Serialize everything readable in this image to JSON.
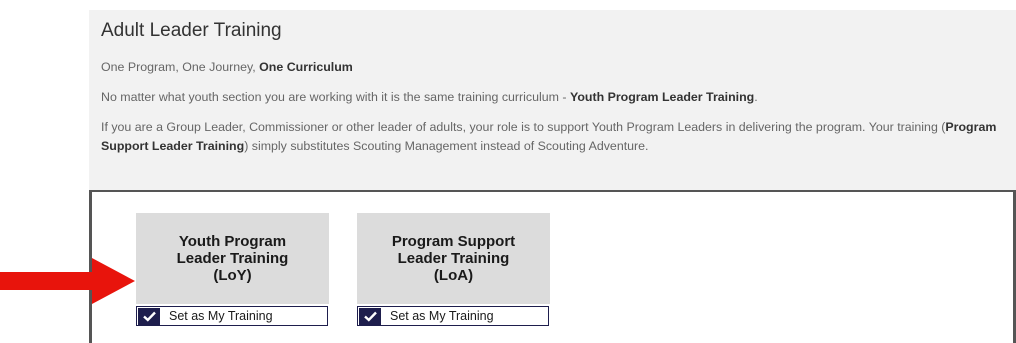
{
  "panel": {
    "title": "Adult Leader Training",
    "line1_prefix": "One Program, One Journey, ",
    "line1_bold": "One Curriculum",
    "line2_prefix": "No matter what youth section you are working with it is the same training curriculum - ",
    "line2_bold": "Youth Program Leader Training",
    "line2_suffix": ".",
    "line3_a": "If you are a Group Leader, Commissioner or other leader of adults, your role is to support Youth Program Leaders in delivering the program. Your training (",
    "line3_bold": "Program Support Leader Training",
    "line3_b": ") simply substitutes Scouting Management instead of Scouting Adventure."
  },
  "tiles": [
    {
      "title": "Youth Program\nLeader Training\n(LoY)",
      "button_label": "Set as My Training",
      "checked": true
    },
    {
      "title": "Program Support\nLeader Training\n(LoA)",
      "button_label": "Set as My Training",
      "checked": true
    }
  ],
  "annotation": {
    "arrow_color": "#e8140c",
    "arrow_direction": "right"
  },
  "colors": {
    "button_accent": "#1e1e4d",
    "tile_bg": "#dcdcdc",
    "panel_bg": "#f2f2f2"
  }
}
